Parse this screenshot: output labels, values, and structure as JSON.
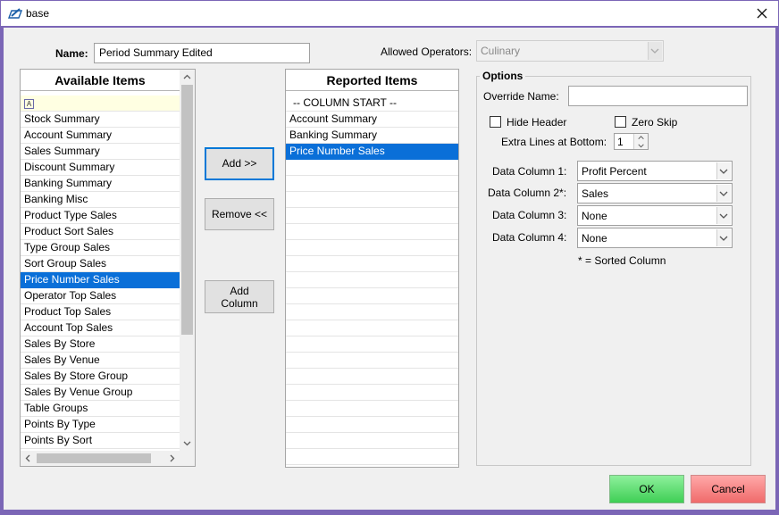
{
  "window": {
    "title": "base"
  },
  "name_field": {
    "label": "Name:",
    "value": "Period Summary Edited"
  },
  "allowed_operators": {
    "label": "Allowed Operators:",
    "value": "Culinary"
  },
  "available_items": {
    "header": "Available Items",
    "items": [
      "Stock Summary",
      "Account Summary",
      "Sales Summary",
      "Discount Summary",
      "Banking Summary",
      "Banking Misc",
      "Product Type Sales",
      "Product Sort Sales",
      "Type Group Sales",
      "Sort Group Sales",
      "Price Number Sales",
      "Operator Top Sales",
      "Product Top Sales",
      "Account Top Sales",
      "Sales By Store",
      "Sales By Venue",
      "Sales By Store Group",
      "Sales By Venue Group",
      "Table Groups",
      "Points By Type",
      "Points By Sort"
    ],
    "selected_index": 10
  },
  "reported_items": {
    "header": "Reported Items",
    "items": [
      "-- COLUMN START --",
      "Account Summary",
      "Banking Summary",
      "Price Number Sales"
    ],
    "selected_index": 3
  },
  "buttons": {
    "add": "Add        >>",
    "remove": "Remove <<",
    "add_column_line1": "Add",
    "add_column_line2": "Column",
    "ok": "OK",
    "cancel": "Cancel"
  },
  "options": {
    "title": "Options",
    "override_name_label": "Override Name:",
    "override_name_value": "",
    "hide_header_label": "Hide Header",
    "zero_skip_label": "Zero Skip",
    "extra_lines_label": "Extra Lines at Bottom:",
    "extra_lines_value": "1",
    "data_columns": [
      {
        "label": "Data Column 1:",
        "value": "Profit Percent"
      },
      {
        "label": "Data Column 2*:",
        "value": "Sales"
      },
      {
        "label": "Data Column 3:",
        "value": "None"
      },
      {
        "label": "Data Column 4:",
        "value": "None"
      }
    ],
    "sorted_note": "* = Sorted Column"
  },
  "icons": {
    "app": "pencil-app-icon",
    "close": "close-icon",
    "filter": "filter-icon",
    "dropdown": "chevron-down-icon"
  }
}
